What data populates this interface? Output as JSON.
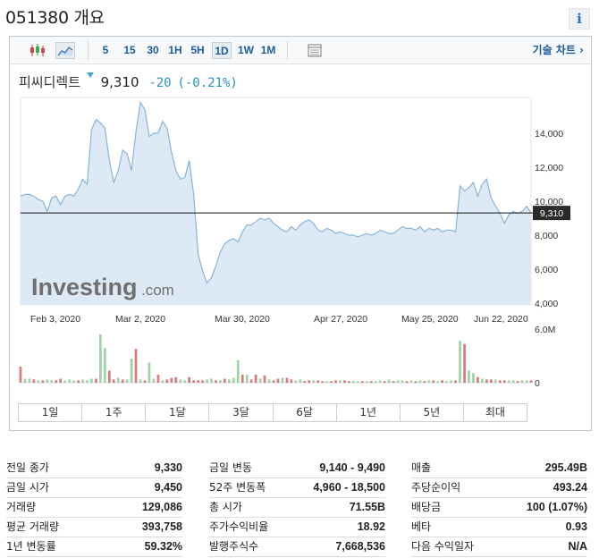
{
  "page": {
    "title": "051380 개요",
    "info_icon": "info-icon"
  },
  "toolbar": {
    "chart_type_icons": [
      "candlestick-icon",
      "area-chart-icon"
    ],
    "timeframes": [
      {
        "label": "5",
        "active": false
      },
      {
        "label": "15",
        "active": false
      },
      {
        "label": "30",
        "active": false
      },
      {
        "label": "1H",
        "active": false
      },
      {
        "label": "5H",
        "active": false
      },
      {
        "label": "1D",
        "active": true
      },
      {
        "label": "1W",
        "active": false
      },
      {
        "label": "1M",
        "active": false
      }
    ],
    "table_icon": "data-table-icon",
    "advanced_chart_label": "기술 차트 ›"
  },
  "quote": {
    "name": "피씨디렉트",
    "price": "9,310",
    "change": "-20",
    "change_pct": "(-0.21%)",
    "arrow_color": "#3aa7dc"
  },
  "watermark": {
    "brand": "Investing",
    "suffix": ".com"
  },
  "chart_data": {
    "type": "area",
    "x_tick_labels": [
      "Feb 3, 2020",
      "Mar 2, 2020",
      "Mar 30, 2020",
      "Apr 27, 2020",
      "May 25, 2020",
      "Jun 22, 2020"
    ],
    "y_tick_labels": [
      "14,000",
      "12,000",
      "10,000",
      "8,000",
      "6,000",
      "4,000"
    ],
    "y_ticks": [
      14000,
      12000,
      10000,
      8000,
      6000,
      4000
    ],
    "ylim": [
      3900,
      16100
    ],
    "last_price": 9310,
    "last_price_label": "9,310",
    "volume_axis_labels": [
      "6.0M",
      "0"
    ],
    "volume_max": 6000000,
    "line_color": "#8ab4d9",
    "fill_color": "#dde9f4",
    "up_color": "#9ed3a5",
    "down_color": "#d97a7a",
    "price": [
      10300,
      10400,
      10400,
      10300,
      10100,
      10000,
      9400,
      10200,
      10300,
      9800,
      10300,
      10400,
      10300,
      10700,
      11300,
      11000,
      14200,
      14800,
      14600,
      14300,
      12400,
      11100,
      11800,
      13000,
      12800,
      11800,
      14100,
      15800,
      15400,
      13800,
      14000,
      14000,
      14700,
      14300,
      12900,
      11800,
      11300,
      11400,
      12400,
      10400,
      6900,
      5900,
      5200,
      5500,
      6200,
      7000,
      7500,
      7700,
      7800,
      7600,
      8200,
      8600,
      8600,
      8800,
      9000,
      8900,
      9000,
      8700,
      8500,
      8300,
      8200,
      8500,
      8300,
      8600,
      8800,
      8900,
      8700,
      8300,
      8200,
      8400,
      8300,
      8100,
      8200,
      8100,
      8000,
      8000,
      7900,
      8000,
      8100,
      8000,
      8100,
      8300,
      8200,
      8100,
      8100,
      8300,
      8500,
      8400,
      8400,
      8300,
      8500,
      8200,
      8400,
      8300,
      8400,
      8200,
      8300,
      8300,
      8200,
      10900,
      10600,
      10800,
      11100,
      10300,
      11000,
      11300,
      10200,
      9700,
      9300,
      8700,
      9200,
      9400,
      9300,
      9400,
      9700,
      9300
    ],
    "volume_up": [
      2.0,
      0.5,
      0.5,
      0.4,
      0.3,
      0.3,
      0.4,
      0.3,
      0.3,
      0.5,
      0.3,
      0.4,
      0.3,
      0.3,
      0.4,
      0.3,
      0.5,
      0.5,
      6.0,
      4.3,
      1.5,
      0.4,
      0.6,
      0.4,
      0.4,
      3.0,
      4.2,
      0.4,
      0.3,
      2.5,
      0.5,
      1.0,
      0.3,
      0.4,
      0.6,
      0.7,
      0.4,
      0.3,
      0.7,
      0.3,
      0.3,
      0.3,
      0.4,
      0.5,
      0.3,
      0.3,
      0.5,
      0.4,
      0.6,
      2.8,
      1.0,
      1.0,
      0.4,
      1.0,
      0.5,
      0.9,
      0.4,
      0.3,
      0.5,
      0.6,
      0.6,
      0.4,
      0.3,
      0.4,
      0.2,
      0.3,
      0.3,
      0.3,
      0.2,
      0.2,
      0.2,
      0.3,
      0.3,
      0.3,
      0.2,
      0.2,
      0.2,
      0.2,
      0.2,
      0.2,
      0.2,
      0.3,
      0.2,
      0.4,
      0.2,
      0.3,
      0.3,
      0.2,
      0.3,
      0.2,
      0.3,
      0.2,
      0.3,
      0.3,
      0.2,
      0.3,
      0.2,
      0.3,
      0.3,
      5.2,
      4.8,
      1.5,
      1.2,
      0.7,
      0.5,
      0.4,
      0.4,
      0.4,
      0.3,
      0.3,
      0.3,
      0.3,
      0.2,
      0.3,
      0.3,
      0.3
    ],
    "volume_dir": [
      "d",
      "u",
      "u",
      "d",
      "u",
      "d",
      "u",
      "u",
      "d",
      "d",
      "u",
      "u",
      "u",
      "d",
      "u",
      "u",
      "u",
      "d",
      "u",
      "u",
      "d",
      "d",
      "u",
      "d",
      "u",
      "u",
      "d",
      "u",
      "d",
      "u",
      "u",
      "d",
      "u",
      "d",
      "d",
      "d",
      "u",
      "u",
      "d",
      "d",
      "d",
      "d",
      "u",
      "u",
      "d",
      "u",
      "d",
      "u",
      "u",
      "u",
      "d",
      "u",
      "d",
      "d",
      "u",
      "d",
      "u",
      "d",
      "d",
      "u",
      "d",
      "d",
      "u",
      "u",
      "d",
      "d",
      "u",
      "d",
      "d",
      "u",
      "d",
      "d",
      "u",
      "d",
      "d",
      "u",
      "u",
      "d",
      "u",
      "d",
      "u",
      "u",
      "d",
      "u",
      "d",
      "u",
      "u",
      "d",
      "u",
      "d",
      "u",
      "d",
      "u",
      "d",
      "u",
      "d",
      "u",
      "u",
      "d",
      "u",
      "d",
      "u",
      "u",
      "d",
      "u",
      "d",
      "d",
      "u",
      "d",
      "d",
      "u",
      "u",
      "d",
      "u",
      "u",
      "d"
    ]
  },
  "range_buttons": [
    "1일",
    "1주",
    "1달",
    "3달",
    "6달",
    "1년",
    "5년",
    "최대"
  ],
  "stats": {
    "col1": [
      {
        "k": "전일 종가",
        "v": "9,330"
      },
      {
        "k": "금일 시가",
        "v": "9,450"
      },
      {
        "k": "거래량",
        "v": "129,086"
      },
      {
        "k": "평균 거래량",
        "v": "393,758"
      },
      {
        "k": "1년 변동률",
        "v": "59.32%"
      }
    ],
    "col2": [
      {
        "k": "금일 변동",
        "v": "9,140 - 9,490"
      },
      {
        "k": "52주 변동폭",
        "v": "4,960 - 18,500"
      },
      {
        "k": "총 시가",
        "v": "71.55B"
      },
      {
        "k": "주가수익비율",
        "v": "18.92"
      },
      {
        "k": "발행주식수",
        "v": "7,668,536"
      }
    ],
    "col3": [
      {
        "k": "매출",
        "v": "295.49B"
      },
      {
        "k": "주당순이익",
        "v": "493.24"
      },
      {
        "k": "배당금",
        "v": "100 (1.07%)"
      },
      {
        "k": "베타",
        "v": "0.93"
      },
      {
        "k": "다음 수익일자",
        "v": "N/A"
      }
    ]
  }
}
